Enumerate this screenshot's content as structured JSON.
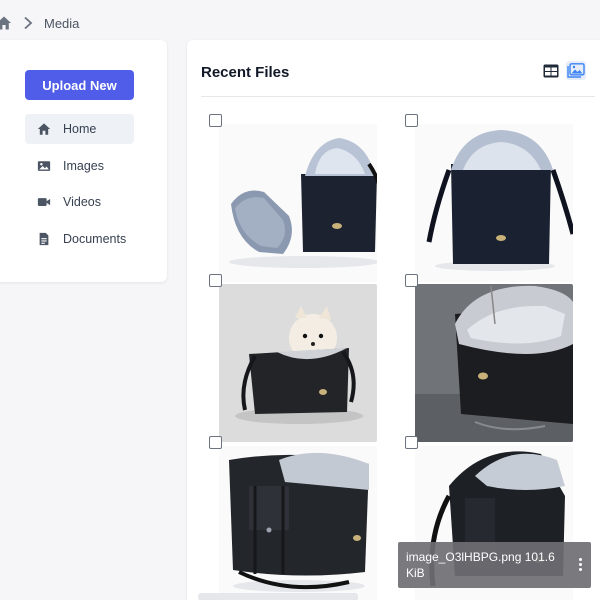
{
  "breadcrumb": {
    "current": "Media"
  },
  "sidebar": {
    "upload_label": "Upload New",
    "items": [
      {
        "label": "Home",
        "icon": "home-icon",
        "active": true
      },
      {
        "label": "Images",
        "icon": "image-icon"
      },
      {
        "label": "Videos",
        "icon": "video-icon"
      },
      {
        "label": "Documents",
        "icon": "document-icon"
      }
    ]
  },
  "main": {
    "title": "Recent Files",
    "view_modes": [
      "grid-icon",
      "gallery-icon"
    ],
    "active_view": "gallery",
    "files": [
      {
        "thumb": "pet carrier bag with cushion"
      },
      {
        "thumb": "black pet carrier bag"
      },
      {
        "thumb": "white dog in pet carrier"
      },
      {
        "thumb": "carrier bag close-up on wet floor"
      },
      {
        "thumb": "carrier bag front view"
      },
      {
        "thumb": "carrier bag side view",
        "caption": "image_O3lHBPG.png 101.6 KiB"
      }
    ]
  },
  "colors": {
    "accent": "#4f5de8",
    "active_bg": "#eef1f6"
  }
}
